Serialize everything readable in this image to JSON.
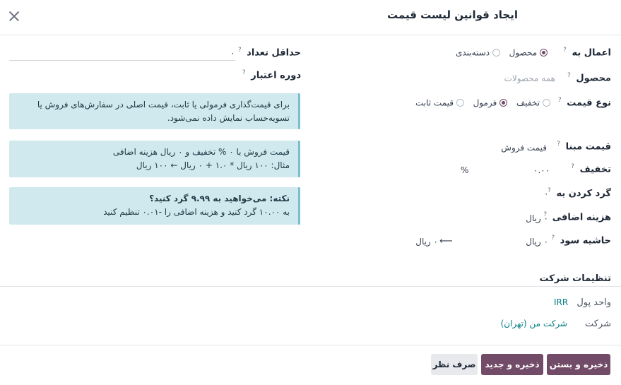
{
  "dialog": {
    "title": "ایجاد قوانین لیست قیمت"
  },
  "apply_on": {
    "label": "اعمال به",
    "options": [
      "محصول",
      "دسته‌بندی"
    ],
    "selected": "محصول"
  },
  "product": {
    "label": "محصول",
    "placeholder": "همه محصولات"
  },
  "price_type": {
    "label": "نوع قیمت",
    "options": [
      "تخفیف",
      "فرمول",
      "قیمت ثابت"
    ],
    "selected": "فرمول"
  },
  "base_price": {
    "label": "قیمت مبنا",
    "value": "قیمت فروش"
  },
  "discount": {
    "label": "تخفیف",
    "value": "۰.۰۰",
    "unit": "%"
  },
  "round_to": {
    "label": "گرد کردن به",
    "value": "۰"
  },
  "extra_fee": {
    "label": "هزینه اضافی",
    "value": "۰ ریال"
  },
  "margin": {
    "label": "حاشیه سود",
    "min_value": "۰ ریال",
    "max_value": "۰ ریال",
    "arrow": "⟵"
  },
  "min_qty": {
    "label": "حداقل تعداد",
    "value": "۰"
  },
  "validity": {
    "label": "دوره اعتبار"
  },
  "alerts": {
    "formula_info": {
      "line1": "برای قیمت‌گذاری فرمولی یا ثابت، قیمت اصلی در سفارش‌های فروش یا",
      "line2": "تسویه‌حساب نمایش داده نمی‌شود."
    },
    "example": {
      "line1": "قیمت فروش با ۰ % تخفیف و ۰ ریال هزینه اضافی",
      "line2": "مثال: ۱۰۰ ریال * ۱.۰ + ۰ ریال ← ۱۰۰ ریال"
    },
    "tip": {
      "title": "نکته: می‌خواهید به ۹.۹۹ گرد کنید؟",
      "body": "به ۱۰.۰۰ گرد کنید و هزینه اضافی را -۰.۰۱ تنظیم کنید"
    }
  },
  "company_settings": {
    "section_title": "تنظیمات شرکت",
    "currency_label": "واحد پول",
    "currency_value": "IRR",
    "company_label": "شرکت",
    "company_value": "شرکت من (تهران)"
  },
  "footer": {
    "save_close": "ذخیره و بستن",
    "save_new": "ذخیره و جدید",
    "discard": "صرف نظر"
  },
  "colors": {
    "primary": "#714b67",
    "alert_bg": "#cfe9ee",
    "link": "#017e84"
  },
  "icons": {
    "help": "?",
    "close": "close-icon"
  }
}
